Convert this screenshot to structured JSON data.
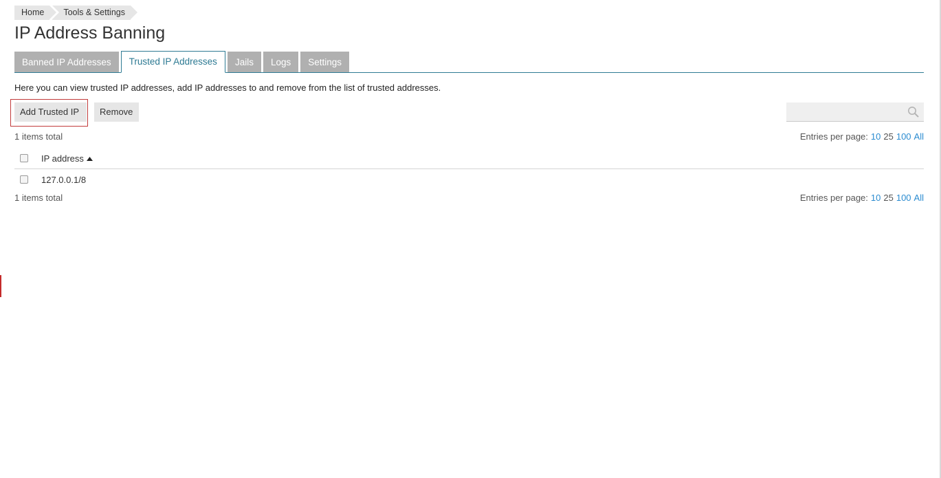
{
  "breadcrumb": {
    "items": [
      {
        "label": "Home"
      },
      {
        "label": "Tools & Settings"
      }
    ]
  },
  "page": {
    "title": "IP Address Banning",
    "description": "Here you can view trusted IP addresses, add IP addresses to and remove from the list of trusted addresses."
  },
  "tabs": [
    {
      "label": "Banned IP Addresses",
      "active": false
    },
    {
      "label": "Trusted IP Addresses",
      "active": true
    },
    {
      "label": "Jails",
      "active": false
    },
    {
      "label": "Logs",
      "active": false
    },
    {
      "label": "Settings",
      "active": false
    }
  ],
  "toolbar": {
    "add_label": "Add Trusted IP",
    "remove_label": "Remove",
    "search_placeholder": "",
    "search_icon": "search-icon"
  },
  "list": {
    "total_text": "1 items total",
    "pager_label": "Entries per page:",
    "pager_options": [
      "10",
      "25",
      "100",
      "All"
    ],
    "pager_current": "25",
    "columns": [
      {
        "label": "IP address",
        "sort": "ascending"
      }
    ],
    "rows": [
      {
        "ip": "127.0.0.1/8"
      }
    ]
  },
  "colors": {
    "accent": "#2d7a93",
    "link": "#2a8bd0",
    "tab_inactive": "#b0b0b0",
    "focus_ring": "#c13a3a"
  }
}
